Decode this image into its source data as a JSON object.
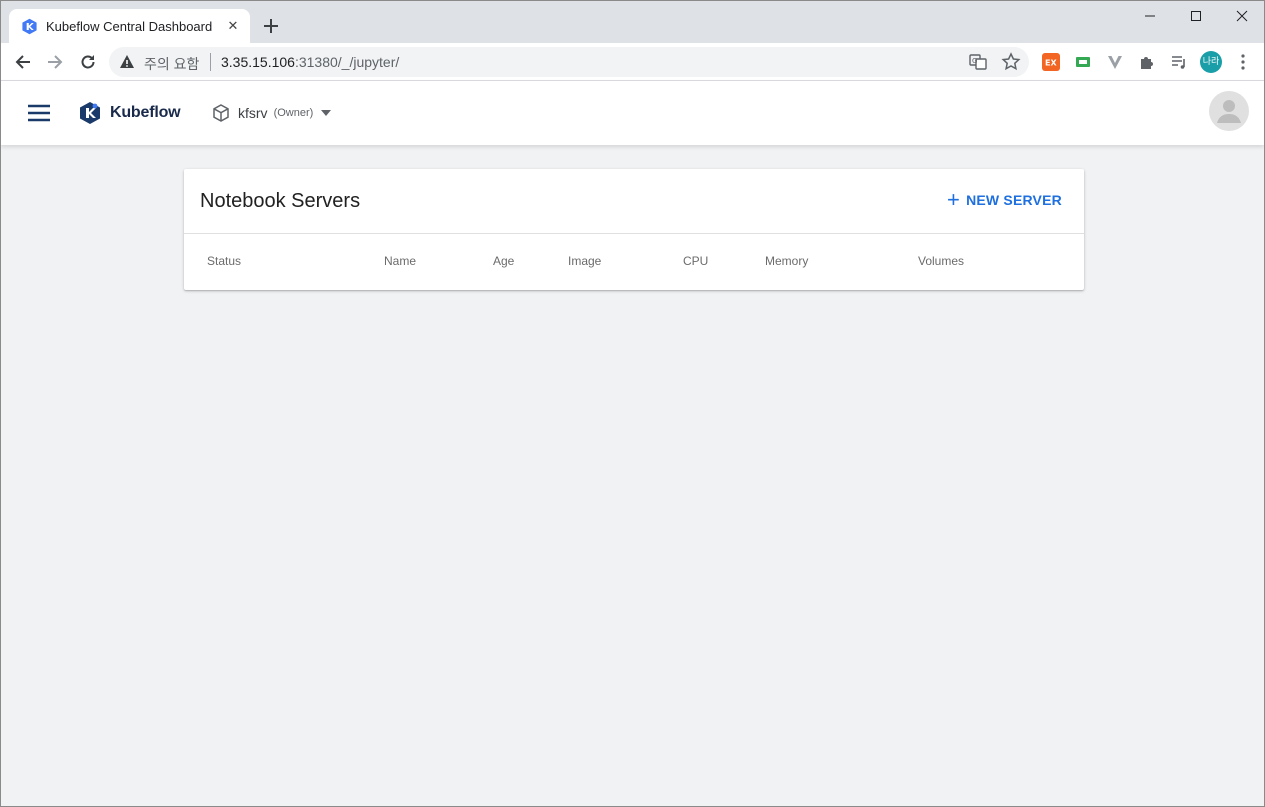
{
  "browser": {
    "tab_title": "Kubeflow Central Dashboard",
    "new_tab_icon": "plus-icon",
    "security_label": "주의 요함",
    "url_host": "3.35.15.106",
    "url_path": ":31380/_/jupyter/",
    "profile_initials": "나라",
    "profile_color": "#1a9ea8",
    "extensions": [
      {
        "name": "ex-extension-icon",
        "color": "#f26522",
        "label": "EX"
      },
      {
        "name": "screen-extension-icon",
        "color": "#34a853"
      },
      {
        "name": "v-extension-icon",
        "color": "#9aa0a6"
      },
      {
        "name": "puzzle-extension-icon",
        "color": "#5f6368"
      },
      {
        "name": "reading-list-icon",
        "color": "#5f6368"
      }
    ]
  },
  "header": {
    "brand": "Kubeflow",
    "namespace": "kfsrv",
    "namespace_role": "(Owner)"
  },
  "card": {
    "title": "Notebook Servers",
    "new_server_label": "NEW SERVER",
    "columns": [
      "Status",
      "Name",
      "Age",
      "Image",
      "CPU",
      "Memory",
      "Volumes"
    ]
  },
  "colors": {
    "accent": "#1e6fe0",
    "background": "#f1f2f4",
    "brand_text": "#1a2a4a"
  }
}
